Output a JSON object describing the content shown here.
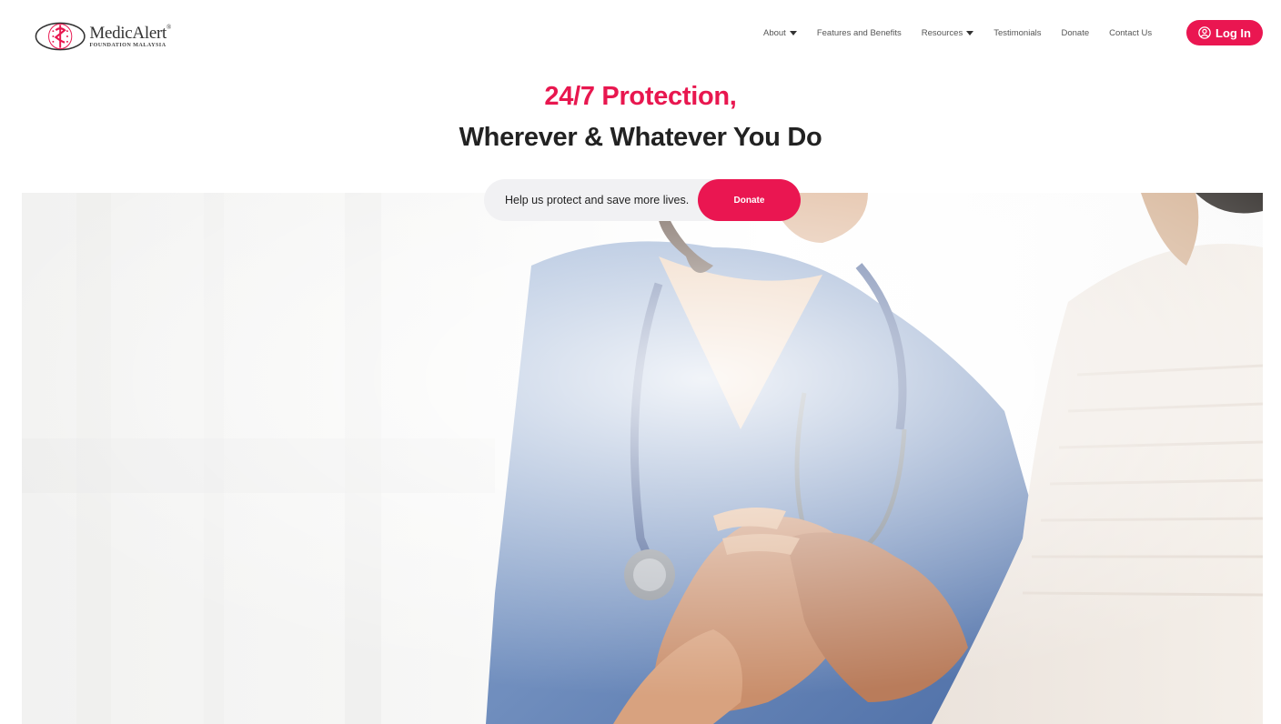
{
  "brand": {
    "name": "MedicAlert",
    "trademark": "®",
    "subtitle": "FOUNDATION MALAYSIA",
    "accent_color": "#ea1651"
  },
  "nav": {
    "items": [
      {
        "label": "About",
        "has_dropdown": true
      },
      {
        "label": "Features and Benefits",
        "has_dropdown": false
      },
      {
        "label": "Resources",
        "has_dropdown": true
      },
      {
        "label": "Testimonials",
        "has_dropdown": false
      },
      {
        "label": "Donate",
        "has_dropdown": false
      },
      {
        "label": "Contact Us",
        "has_dropdown": false
      }
    ],
    "login_label": "Log In",
    "login_icon": "user-circle-icon"
  },
  "hero": {
    "title_line1": "24/7 Protection,",
    "title_line2": "Wherever & Whatever You Do"
  },
  "donate_banner": {
    "text": "Help us protect and save more lives.",
    "button_label": "Donate"
  }
}
